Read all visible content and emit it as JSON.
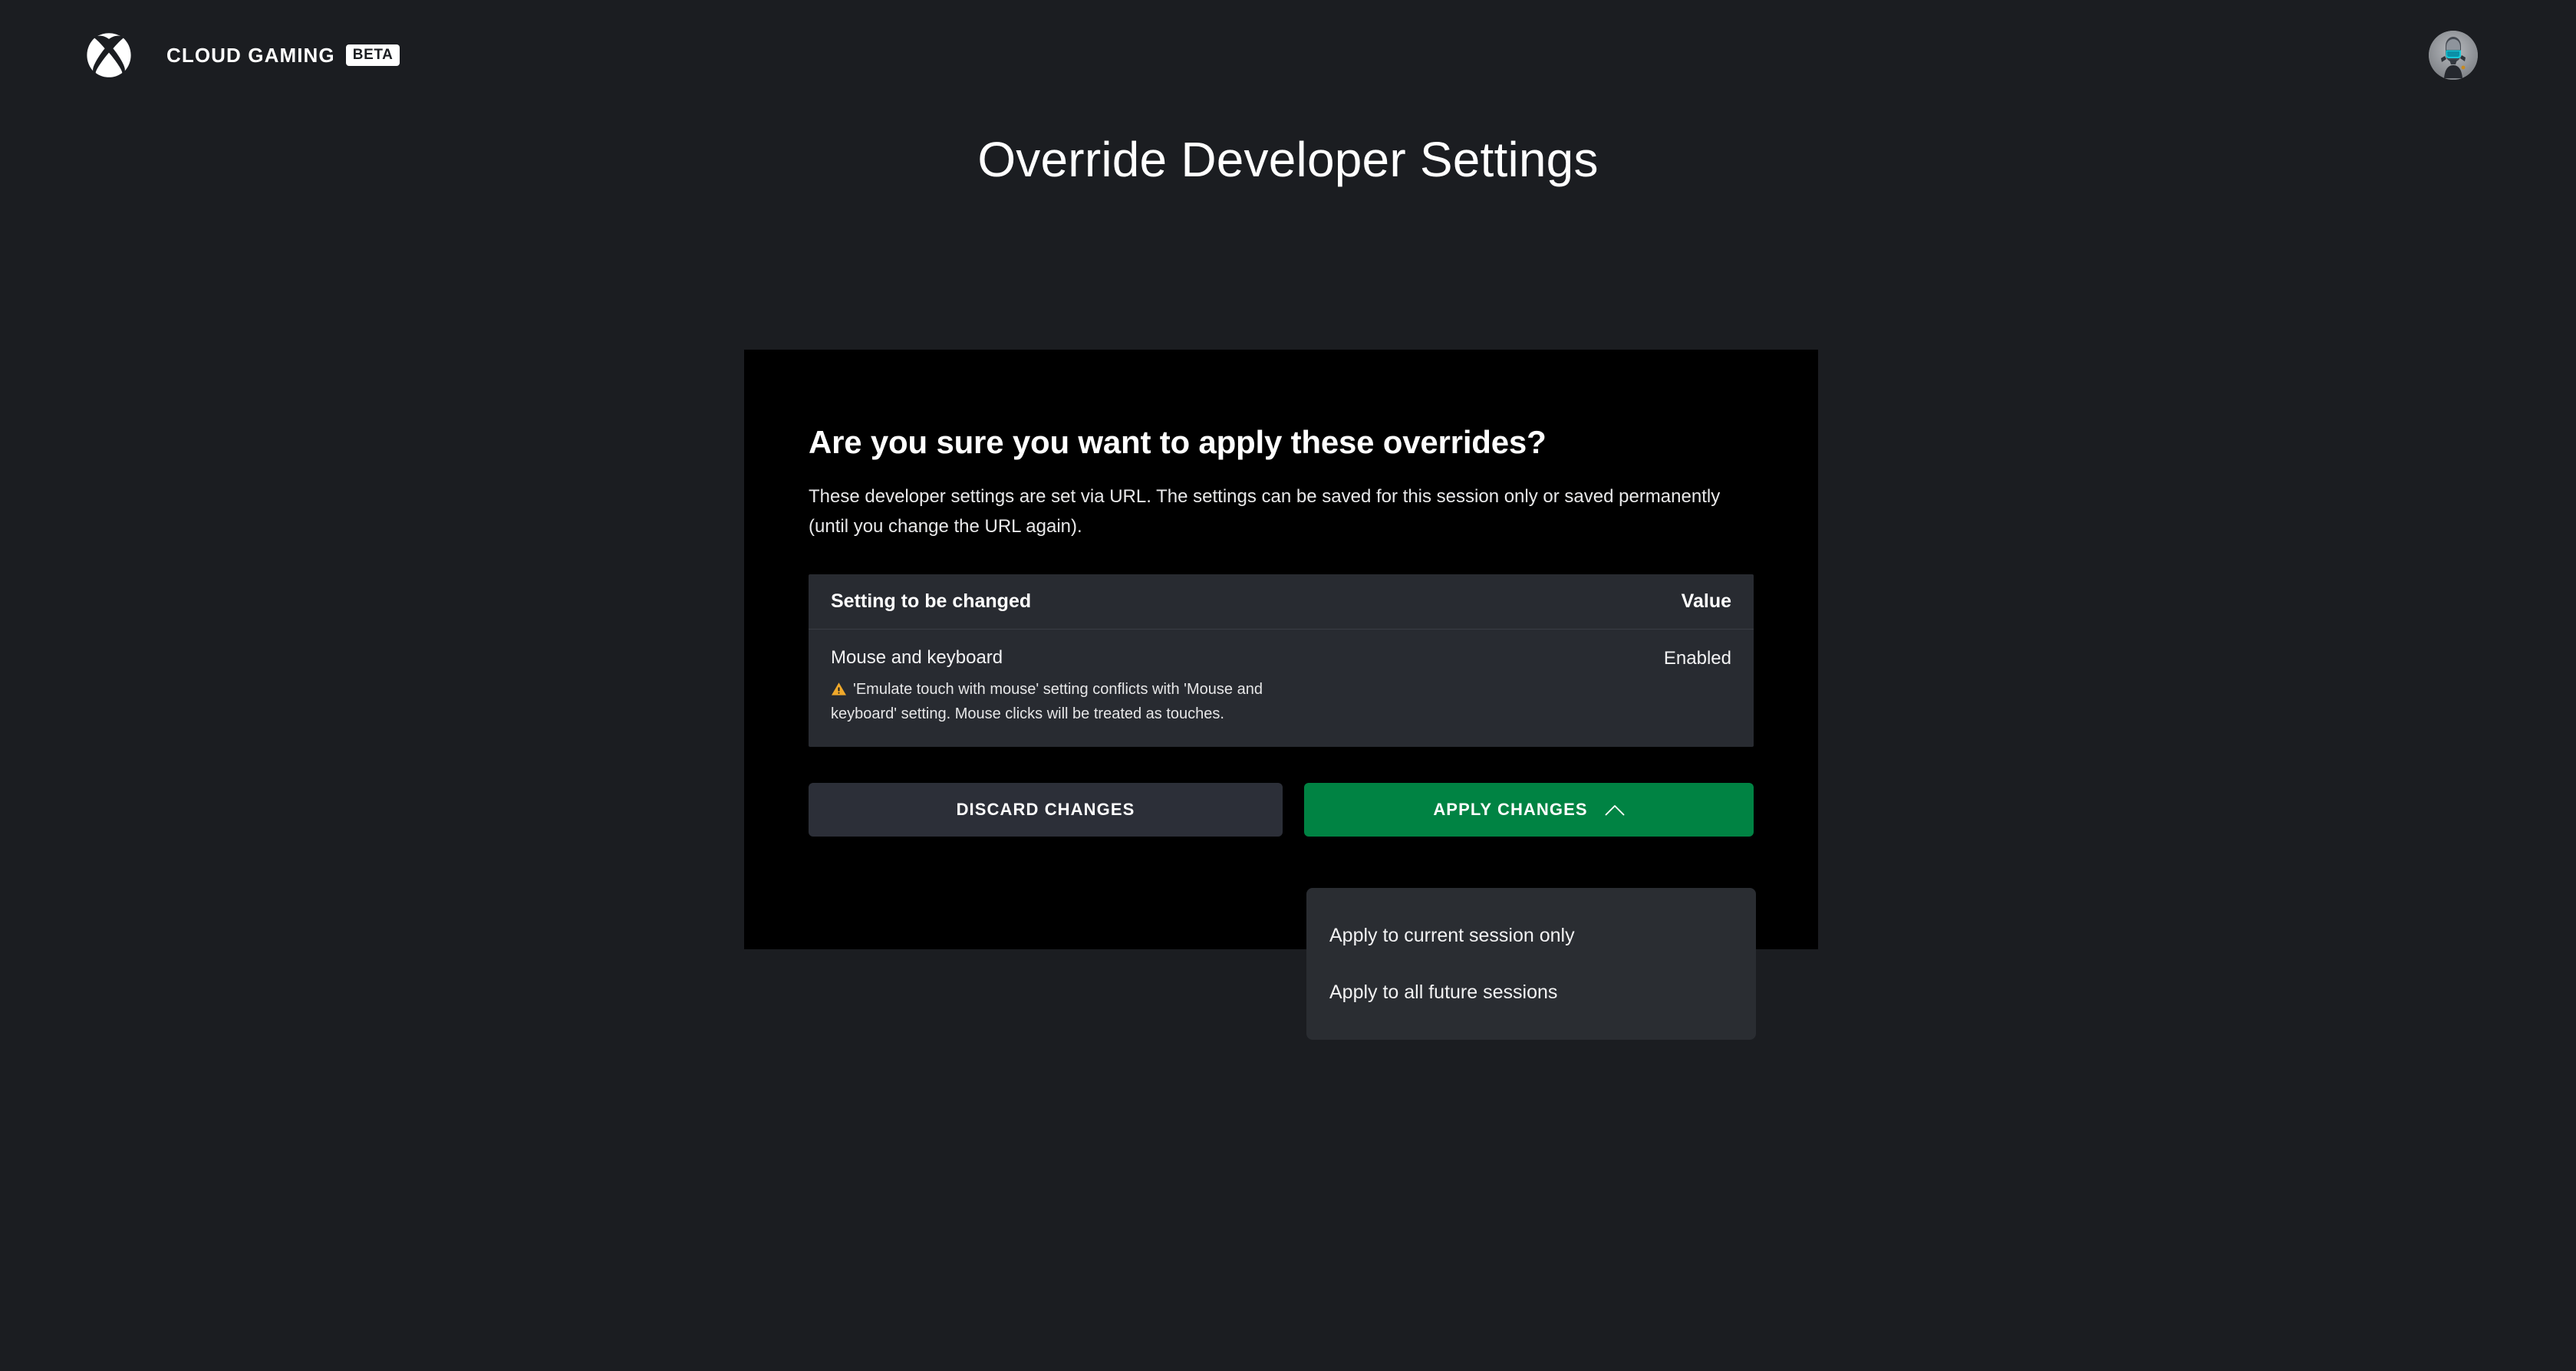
{
  "header": {
    "logo_icon": "xbox-logo-icon",
    "brand_name": "CLOUD GAMING",
    "badge": "BETA",
    "avatar_icon": "avatar-gamerpic"
  },
  "page": {
    "title": "Override Developer Settings",
    "background_color": "#1b1d21"
  },
  "dialog": {
    "heading": "Are you sure you want to apply these overrides?",
    "body": "These developer settings are set via URL. The settings can be saved for this session only or saved permanently (until you change the URL again).",
    "background_color": "#000000",
    "table": {
      "columns": {
        "setting": "Setting to be changed",
        "value": "Value"
      },
      "rows": [
        {
          "name": "Mouse and keyboard",
          "warning_icon": "warning-triangle-icon",
          "warning": "'Emulate touch with mouse' setting conflicts with 'Mouse and keyboard' setting. Mouse clicks will be treated as touches.",
          "value": "Enabled"
        }
      ]
    },
    "buttons": {
      "discard": "DISCARD CHANGES",
      "apply": "APPLY CHANGES",
      "apply_chevron_icon": "chevron-up-icon",
      "apply_color": "#008343",
      "discard_color": "#2c2f38"
    },
    "dropdown": {
      "expanded": true,
      "items": [
        "Apply to current session only",
        "Apply to all future sessions"
      ]
    }
  },
  "colors": {
    "accent_green": "#008343",
    "warning_amber": "#f0a92b",
    "table_bg": "#282b31",
    "menu_bg": "#2a2d32"
  }
}
